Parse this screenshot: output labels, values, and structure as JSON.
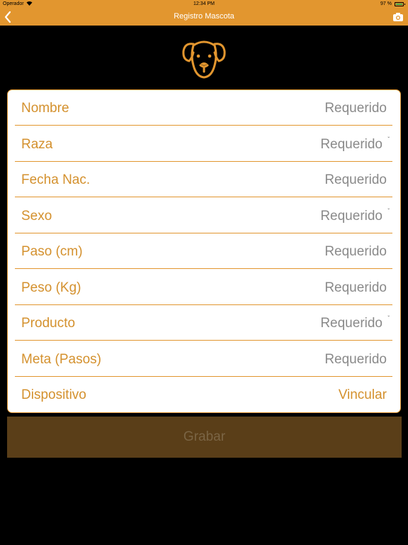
{
  "status_bar": {
    "carrier": "Operador",
    "time": "12:34 PM",
    "battery": "97 %"
  },
  "nav": {
    "title": "Registro Mascota",
    "back_icon": "chevron-left-icon",
    "camera_icon": "camera-icon"
  },
  "header_icon": "dog-face-icon",
  "form": {
    "rows": [
      {
        "label": "Nombre",
        "value": "Requerido",
        "caret": false
      },
      {
        "label": "Raza",
        "value": "Requerido",
        "caret": true
      },
      {
        "label": "Fecha Nac.",
        "value": "Requerido",
        "caret": false
      },
      {
        "label": "Sexo",
        "value": "Requerido",
        "caret": true
      },
      {
        "label": "Paso (cm)",
        "value": "Requerido",
        "caret": false
      },
      {
        "label": "Peso (Kg)",
        "value": "Requerido",
        "caret": false
      },
      {
        "label": "Producto",
        "value": "Requerido",
        "caret": true
      },
      {
        "label": "Meta (Pasos)",
        "value": "Requerido",
        "caret": false
      },
      {
        "label": "Dispositivo",
        "value": "Vincular",
        "caret": false
      }
    ],
    "caret_glyph": "ˇ"
  },
  "save_button": {
    "label": "Grabar"
  },
  "colors": {
    "accent": "#E2962F",
    "label": "#D4912E",
    "placeholder": "#8A8A8A",
    "button_bg": "#5A3E18"
  }
}
